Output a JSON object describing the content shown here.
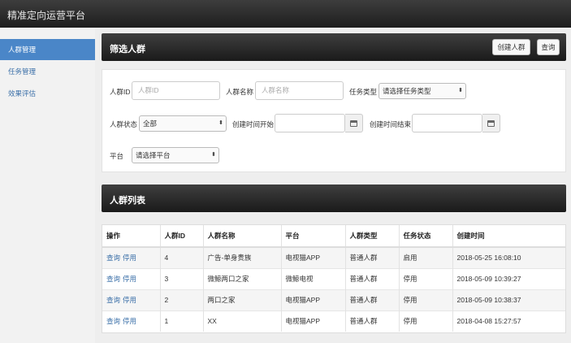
{
  "app": {
    "title": "精准定向运营平台"
  },
  "sidebar": {
    "items": [
      {
        "label": "人群管理"
      },
      {
        "label": "任务管理"
      },
      {
        "label": "效果评估"
      }
    ]
  },
  "filter": {
    "title": "筛选人群",
    "create_label": "创建人群",
    "query_label": "查询",
    "crowd_id_label": "人群ID",
    "crowd_id_placeholder": "人群ID",
    "crowd_name_label": "人群名称",
    "crowd_name_placeholder": "人群名称",
    "task_type_label": "任务类型",
    "task_type_value": "请选择任务类型",
    "status_label": "人群状态",
    "status_value": "全部",
    "start_label": "创建时间开始",
    "end_label": "创建时间结束",
    "platform_label": "平台",
    "platform_value": "请选择平台"
  },
  "list": {
    "title": "人群列表",
    "columns": [
      "操作",
      "人群ID",
      "人群名称",
      "平台",
      "人群类型",
      "任务状态",
      "创建时间"
    ],
    "actions": {
      "view": "查询",
      "stop": "停用"
    },
    "rows": [
      {
        "id": "4",
        "name": "广告-单身贵族",
        "platform": "电视猫APP",
        "type": "普通人群",
        "status": "启用",
        "created": "2018-05-25 16:08:10"
      },
      {
        "id": "3",
        "name": "微鲸两口之家",
        "platform": "微鲸电视",
        "type": "普通人群",
        "status": "停用",
        "created": "2018-05-09 10:39:27"
      },
      {
        "id": "2",
        "name": "两口之家",
        "platform": "电视猫APP",
        "type": "普通人群",
        "status": "停用",
        "created": "2018-05-09 10:38:37"
      },
      {
        "id": "1",
        "name": "XX",
        "platform": "电视猫APP",
        "type": "普通人群",
        "status": "停用",
        "created": "2018-04-08 15:27:57"
      }
    ]
  }
}
